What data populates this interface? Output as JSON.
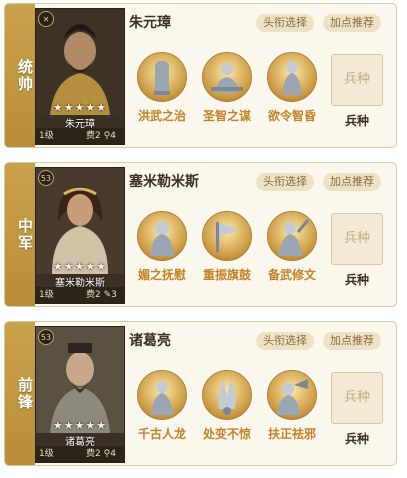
{
  "generals": [
    {
      "position": "统帅",
      "name": "朱元璋",
      "portrait_name": "朱元璋",
      "stars": "★★★★★",
      "level": "1级",
      "cost": "费2",
      "extra": "4",
      "badge": "✕",
      "title_btn": "头衔选择",
      "points_btn": "加点推荐",
      "skills": [
        "洪武之治",
        "圣智之谋",
        "欲令智昏"
      ],
      "troop": "兵种",
      "troop_label": "兵种"
    },
    {
      "position": "中军",
      "name": "塞米勒米斯",
      "portrait_name": "塞米勒米斯",
      "stars": "★★★★★",
      "level": "1级",
      "cost": "费2",
      "extra": "3",
      "badge": "53",
      "title_btn": "头衔选择",
      "points_btn": "加点推荐",
      "skills": [
        "媚之抚慰",
        "重振旗鼓",
        "备武修文"
      ],
      "troop": "兵种",
      "troop_label": "兵种"
    },
    {
      "position": "前锋",
      "name": "诸葛亮",
      "portrait_name": "诸葛亮",
      "stars": "★★★★★",
      "level": "1级",
      "cost": "费2",
      "extra": "4",
      "badge": "53",
      "title_btn": "头衔选择",
      "points_btn": "加点推荐",
      "skills": [
        "千古人龙",
        "处变不惊",
        "扶正祛邪"
      ],
      "troop": "兵种",
      "troop_label": "兵种"
    }
  ]
}
